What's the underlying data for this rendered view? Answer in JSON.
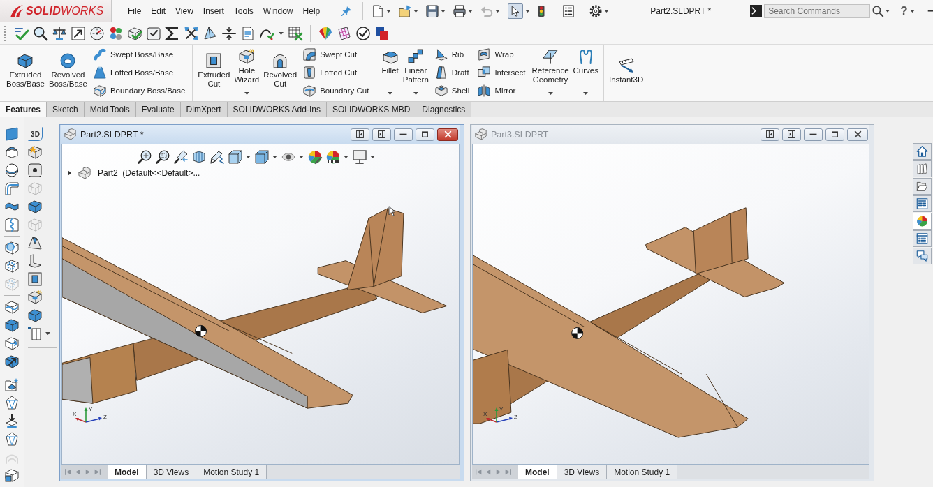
{
  "app_bar": {
    "logo": "**SOLID**WORKS",
    "menu": [
      "File",
      "Edit",
      "View",
      "Insert",
      "Tools",
      "Window",
      "Help"
    ],
    "title": "Part2.SLDPRT *",
    "search": {
      "placeholder": "Search Commands"
    },
    "help": "?"
  },
  "quick_access": [
    {
      "dropdown": true,
      "disabled": false,
      "selected": false
    },
    {
      "dropdown": true,
      "disabled": false,
      "selected": false
    },
    {
      "dropdown": true,
      "disabled": false,
      "selected": false
    },
    {
      "dropdown": true,
      "disabled": false,
      "selected": false
    },
    {
      "dropdown": true,
      "disabled": true,
      "selected": false
    },
    {
      "dropdown": true,
      "disabled": false,
      "selected": true
    },
    {
      "dropdown": false,
      "disabled": false,
      "selected": false
    },
    {
      "dropdown": false,
      "disabled": false,
      "selected": false
    },
    {
      "dropdown": true,
      "disabled": false,
      "selected": false
    }
  ],
  "command_manager": [
    {
      "items": [
        {
          "kind": "large",
          "label": "Extruded Boss/Base",
          "dropdown": false
        },
        {
          "kind": "large",
          "label": "Revolved Boss/Base",
          "dropdown": false
        },
        {
          "kind": "column",
          "labels": [
            "Swept Boss/Base",
            "Lofted Boss/Base",
            "Boundary Boss/Base"
          ]
        }
      ]
    },
    {
      "items": [
        {
          "kind": "large",
          "label": "Extruded Cut",
          "dropdown": false
        },
        {
          "kind": "large",
          "label": "Hole Wizard",
          "dropdown": true
        },
        {
          "kind": "large",
          "label": "Revolved Cut",
          "dropdown": false
        },
        {
          "kind": "column",
          "labels": [
            "Swept Cut",
            "Lofted Cut",
            "Boundary Cut"
          ]
        }
      ]
    },
    {
      "items": [
        {
          "kind": "large",
          "label": "Fillet",
          "dropdown": true
        },
        {
          "kind": "large",
          "label": "Linear Pattern",
          "dropdown": true
        },
        {
          "kind": "column",
          "labels": [
            "Rib",
            "Draft",
            "Shell"
          ]
        },
        {
          "kind": "column",
          "labels": [
            "Wrap",
            "Intersect",
            "Mirror"
          ]
        },
        {
          "kind": "large",
          "label": "Reference Geometry",
          "dropdown": true
        },
        {
          "kind": "large",
          "label": "Curves",
          "dropdown": true
        }
      ]
    },
    {
      "items": [
        {
          "kind": "large",
          "label": "Instant3D",
          "dropdown": false
        }
      ]
    }
  ],
  "tabs": [
    {
      "label": "Features",
      "selected": true
    },
    {
      "label": "Sketch",
      "selected": false
    },
    {
      "label": "Mold Tools",
      "selected": false
    },
    {
      "label": "Evaluate",
      "selected": false
    },
    {
      "label": "DimXpert",
      "selected": false
    },
    {
      "label": "SOLIDWORKS Add-Ins",
      "selected": false
    },
    {
      "label": "SOLIDWORKS MBD",
      "selected": false
    },
    {
      "label": "Diagnostics",
      "selected": false
    }
  ],
  "feature_toolbar": [
    {
      "kind": "tool",
      "disabled": false
    },
    {
      "kind": "tool",
      "disabled": false
    },
    {
      "kind": "tool",
      "disabled": false
    },
    {
      "kind": "tool",
      "disabled": false
    },
    {
      "kind": "tool",
      "disabled": false
    },
    {
      "kind": "tool",
      "disabled": false
    },
    {
      "kind": "separator"
    },
    {
      "kind": "tool",
      "disabled": false
    },
    {
      "kind": "tool",
      "disabled": false
    },
    {
      "kind": "tool",
      "disabled": true
    },
    {
      "kind": "separator"
    },
    {
      "kind": "tool",
      "disabled": false
    },
    {
      "kind": "tool",
      "disabled": false
    },
    {
      "kind": "tool",
      "disabled": false
    },
    {
      "kind": "tool",
      "disabled": false
    },
    {
      "kind": "separator"
    },
    {
      "kind": "tool",
      "disabled": false
    },
    {
      "kind": "tool",
      "disabled": false
    },
    {
      "kind": "tool",
      "disabled": false
    },
    {
      "kind": "tool",
      "disabled": false
    },
    {
      "kind": "tool",
      "disabled": true
    },
    {
      "kind": "tool",
      "disabled": false
    }
  ],
  "sketch_toolbar": [
    {
      "kind": "label",
      "label": "3D",
      "disabled": false,
      "dropdown": false
    },
    {
      "kind": "tool",
      "disabled": false,
      "dropdown": false
    },
    {
      "kind": "tool",
      "disabled": false,
      "dropdown": false
    },
    {
      "kind": "tool",
      "disabled": true,
      "dropdown": false
    },
    {
      "kind": "tool",
      "disabled": false,
      "dropdown": false
    },
    {
      "kind": "tool",
      "disabled": true,
      "dropdown": false
    },
    {
      "kind": "tool",
      "disabled": false,
      "dropdown": false
    },
    {
      "kind": "tool",
      "disabled": false,
      "dropdown": false
    },
    {
      "kind": "tool",
      "disabled": false,
      "dropdown": false
    },
    {
      "kind": "tool",
      "disabled": false,
      "dropdown": false
    },
    {
      "kind": "tool",
      "disabled": false,
      "dropdown": false
    },
    {
      "kind": "tool",
      "disabled": false,
      "dropdown": true
    }
  ],
  "windows": [
    {
      "title": "Part2.SLDPRT *",
      "active": true,
      "view_toolbar": [
        {
          "dropdown": false
        },
        {
          "dropdown": false
        },
        {
          "dropdown": false
        },
        {
          "dropdown": false
        },
        {
          "dropdown": false
        },
        {
          "dropdown": true
        },
        {
          "dropdown": true
        },
        {
          "dropdown": true
        },
        {
          "dropdown": false
        },
        {
          "dropdown": true
        },
        {
          "dropdown": true
        }
      ],
      "feature_tree": {
        "label": "Part2  (Default<<Default>...",
        "expanded": false
      },
      "cursor": true,
      "triad": [
        "X",
        "Y",
        "Z"
      ],
      "tabs": [
        {
          "label": "Model",
          "selected": true
        },
        {
          "label": "3D Views",
          "selected": false
        },
        {
          "label": "Motion Study 1",
          "selected": false
        }
      ]
    },
    {
      "title": "Part3.SLDPRT",
      "active": false,
      "triad": [
        "X",
        "Y",
        "Z"
      ],
      "tabs": [
        {
          "label": "Model",
          "selected": true
        },
        {
          "label": "3D Views",
          "selected": false
        },
        {
          "label": "Motion Study 1",
          "selected": false
        }
      ]
    }
  ],
  "task_pane": [
    {
      "selected": false
    },
    {
      "selected": false
    },
    {
      "selected": false
    },
    {
      "selected": false
    },
    {
      "selected": true
    },
    {
      "selected": false
    },
    {
      "selected": false
    }
  ]
}
